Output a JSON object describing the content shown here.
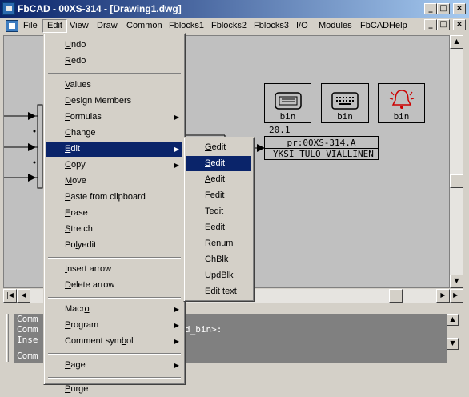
{
  "window": {
    "title": "FbCAD - 00XS-314 - [Drawing1.dwg]",
    "buttons": [
      "_",
      "□",
      "×"
    ]
  },
  "menubar": {
    "items": [
      "File",
      "Edit",
      "View",
      "Draw",
      "Common",
      "Fblocks1",
      "Fblocks2",
      "Fblocks3",
      "I/O",
      "Modules",
      "FbCADHelp"
    ],
    "active": "Edit",
    "mdi_buttons": [
      "_",
      "□",
      "×"
    ]
  },
  "drawing": {
    "symbols": [
      {
        "icon": "display-screen-icon",
        "label": "bin"
      },
      {
        "icon": "keyboard-icon",
        "label": "bin"
      },
      {
        "icon": "alarm-bell-icon",
        "label": "bin"
      }
    ],
    "value_label": "20.1",
    "ref_text": "pr:00XS-314.A",
    "description": "YKSI TULO VIALLINEN"
  },
  "edit_menu": {
    "items": [
      {
        "label": "Undo",
        "mnemonic": "U"
      },
      {
        "label": "Redo",
        "mnemonic": "R"
      },
      {
        "sep": true
      },
      {
        "label": "Values",
        "mnemonic": "V"
      },
      {
        "label": "Design Members",
        "mnemonic": "D"
      },
      {
        "label": "Formulas",
        "mnemonic": "F",
        "submenu": true
      },
      {
        "label": "Change",
        "mnemonic": "C"
      },
      {
        "label": "Edit",
        "mnemonic": "E",
        "submenu": true,
        "highlight": true
      },
      {
        "label": "Copy",
        "mnemonic": "C",
        "submenu": true
      },
      {
        "label": "Move",
        "mnemonic": "M"
      },
      {
        "label": "Paste from clipboard",
        "mnemonic": "P"
      },
      {
        "label": "Erase",
        "mnemonic": "E"
      },
      {
        "label": "Stretch",
        "mnemonic": "S"
      },
      {
        "label": "Polyedit",
        "mnemonic": "l"
      },
      {
        "sep": true
      },
      {
        "label": "Insert arrow",
        "mnemonic": "I"
      },
      {
        "label": "Delete arrow",
        "mnemonic": "D"
      },
      {
        "sep": true
      },
      {
        "label": "Macro",
        "mnemonic": "o",
        "submenu": true
      },
      {
        "label": "Program",
        "mnemonic": "P",
        "submenu": true
      },
      {
        "label": "Comment symbol",
        "mnemonic": "b",
        "submenu": true
      },
      {
        "sep": true
      },
      {
        "label": "Page",
        "mnemonic": "P",
        "submenu": true
      },
      {
        "sep": true
      },
      {
        "label": "Purge",
        "mnemonic": "P"
      }
    ]
  },
  "edit_submenu": {
    "items": [
      {
        "label": "Gedit",
        "mnemonic": "G"
      },
      {
        "label": "Sedit",
        "mnemonic": "S",
        "highlight": true
      },
      {
        "label": "Aedit",
        "mnemonic": "A"
      },
      {
        "label": "Fedit",
        "mnemonic": "F"
      },
      {
        "label": "Tedit",
        "mnemonic": "T"
      },
      {
        "label": "Eedit",
        "mnemonic": "E"
      },
      {
        "label": "Renum",
        "mnemonic": "R"
      },
      {
        "label": "ChBlk",
        "mnemonic": "C"
      },
      {
        "label": "UpdBlk",
        "mnemonic": "U"
      },
      {
        "label": "Edit text",
        "mnemonic": "E"
      }
    ]
  },
  "command_line": {
    "history": [
      "Comm",
      "Comm",
      "Inse"
    ],
    "history_tail": "d_bin>:",
    "prompt": "Comm"
  }
}
